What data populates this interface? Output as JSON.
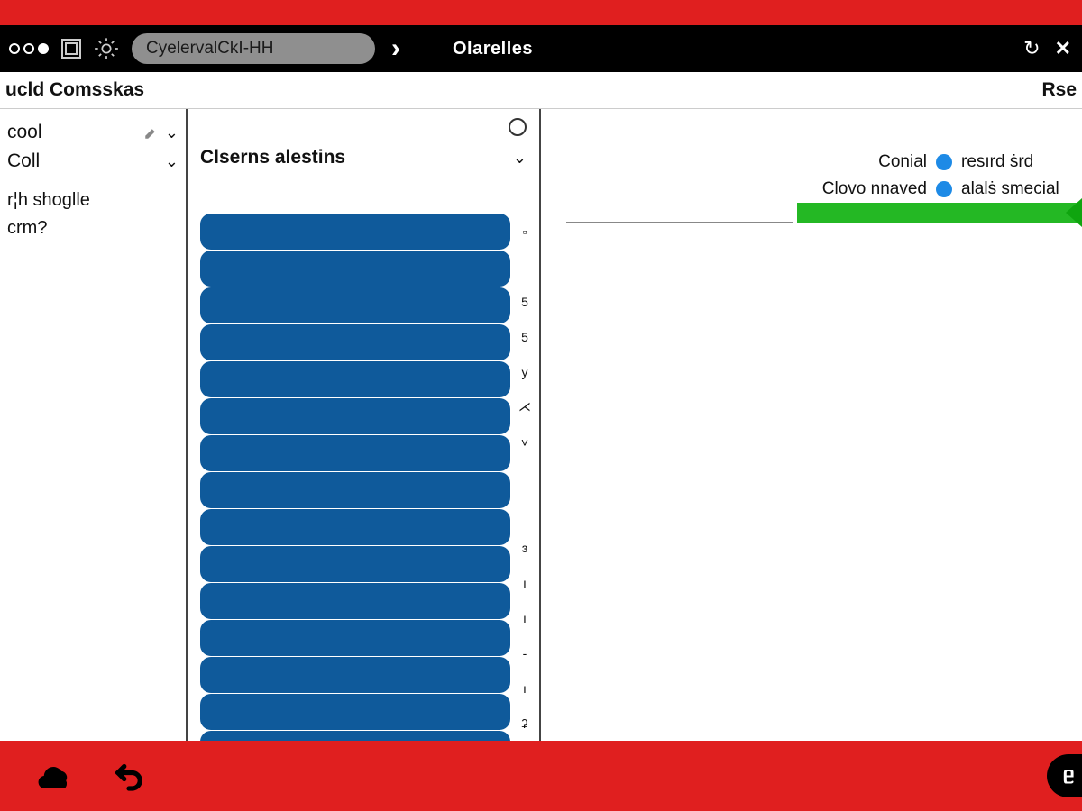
{
  "toolbar": {
    "omnibox_value": "CyelervalCkI-HH",
    "tab_title": "Olarelles"
  },
  "subheader": {
    "left": "ucld Comsskas",
    "right": "Rse"
  },
  "sidebar": {
    "item1": "cool",
    "item2": "Coll",
    "item3": "r¦h shoglle",
    "item4": "crm?"
  },
  "midcol": {
    "heading": "Clserns alestins",
    "scroll_marks": [
      "▫",
      "",
      "5",
      "5",
      "y",
      "⋌",
      "˅",
      "",
      "",
      "ɜ",
      "ı",
      "ı",
      "-",
      "ı",
      "ʡ"
    ]
  },
  "right": {
    "row1_label": "Conial",
    "row1_value": "resırd ṡrd",
    "row2_label": "Clovo nnaved",
    "row2_value": "alalṡ smecial"
  },
  "bottom": {
    "pill": "ᥱ"
  }
}
